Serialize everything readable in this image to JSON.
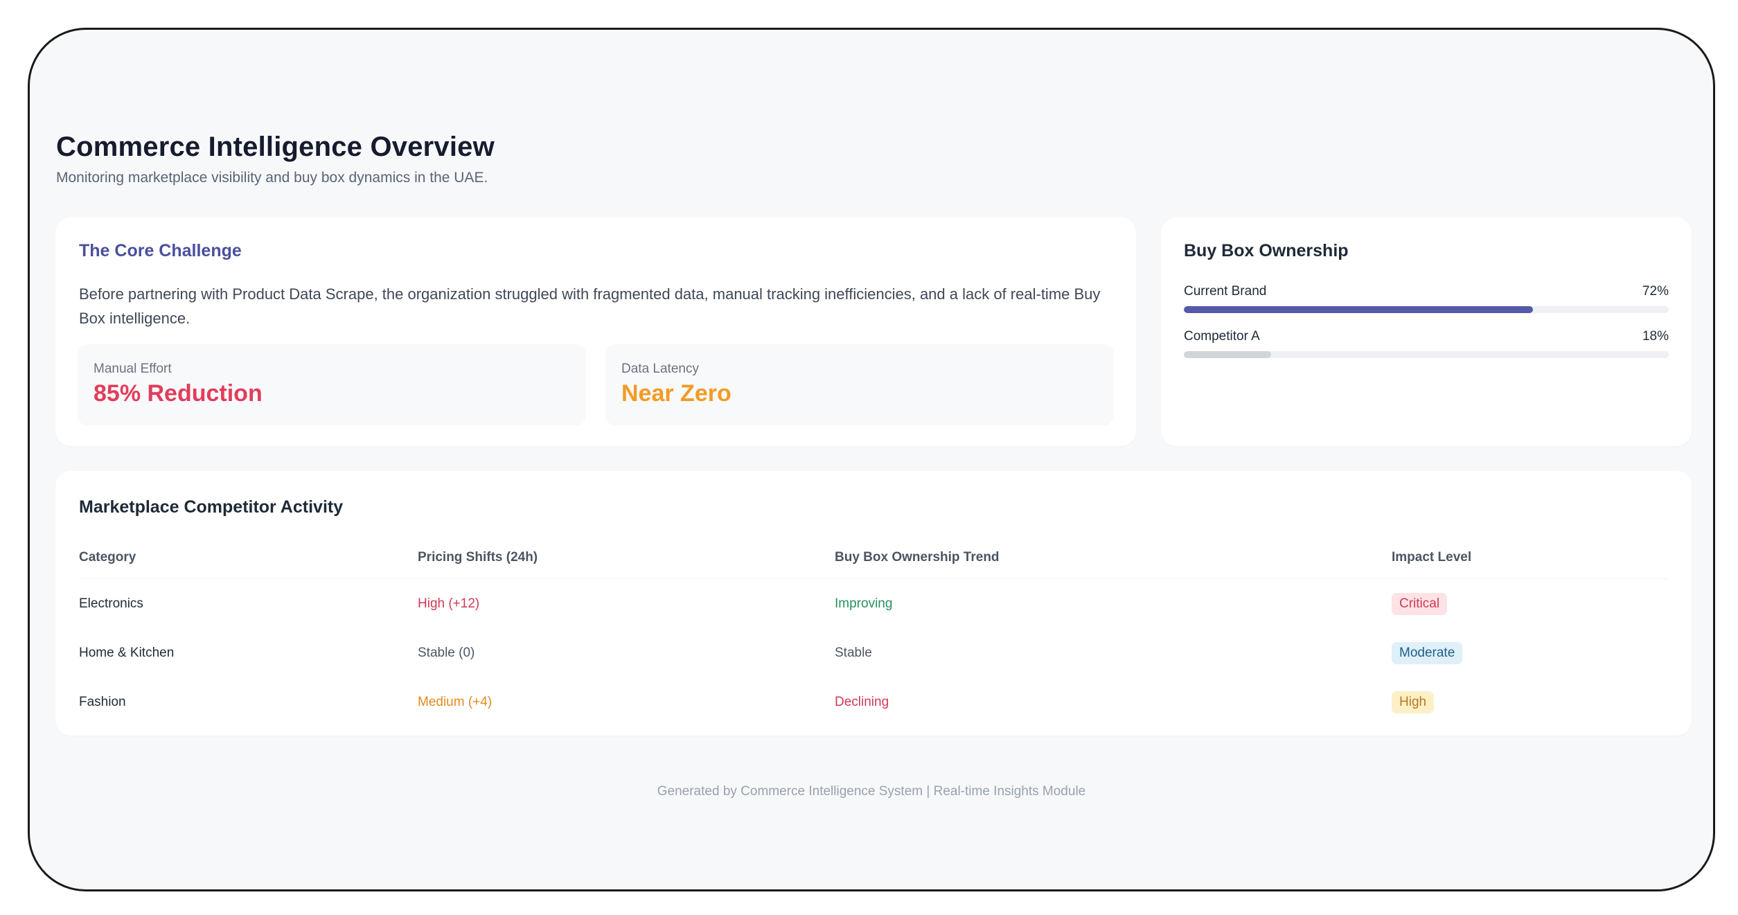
{
  "header": {
    "title": "Commerce Intelligence Overview",
    "subtitle": "Monitoring marketplace visibility and buy box dynamics in the UAE."
  },
  "challenge": {
    "title": "The Core Challenge",
    "text": "Before partnering with Product Data Scrape, the organization struggled with fragmented data, manual tracking inefficiencies, and a lack of real-time Buy Box intelligence.",
    "metrics": [
      {
        "label": "Manual Effort",
        "value": "85% Reduction"
      },
      {
        "label": "Data Latency",
        "value": "Near Zero"
      }
    ]
  },
  "buybox": {
    "title": "Buy Box Ownership",
    "rows": [
      {
        "label": "Current Brand",
        "value_text": "72%",
        "percent": 72
      },
      {
        "label": "Competitor A",
        "value_text": "18%",
        "percent": 18
      }
    ]
  },
  "activity": {
    "title": "Marketplace Competitor Activity",
    "columns": [
      "Category",
      "Pricing Shifts (24h)",
      "Buy Box Ownership Trend",
      "Impact Level"
    ],
    "rows": [
      {
        "category": "Electronics",
        "pricing": "High (+12)",
        "trend": "Improving",
        "impact": "Critical"
      },
      {
        "category": "Home & Kitchen",
        "pricing": "Stable (0)",
        "trend": "Stable",
        "impact": "Moderate"
      },
      {
        "category": "Fashion",
        "pricing": "Medium (+4)",
        "trend": "Declining",
        "impact": "High"
      }
    ]
  },
  "colors": {
    "accent": "#4a4f9c",
    "brand_bar": "#555aa8",
    "reduction": "#e23d5b",
    "latency": "#f29b24",
    "improving": "#249063",
    "declining": "#d03a55"
  },
  "footer": {
    "text": "Generated by Commerce Intelligence System | Real-time Insights Module"
  }
}
